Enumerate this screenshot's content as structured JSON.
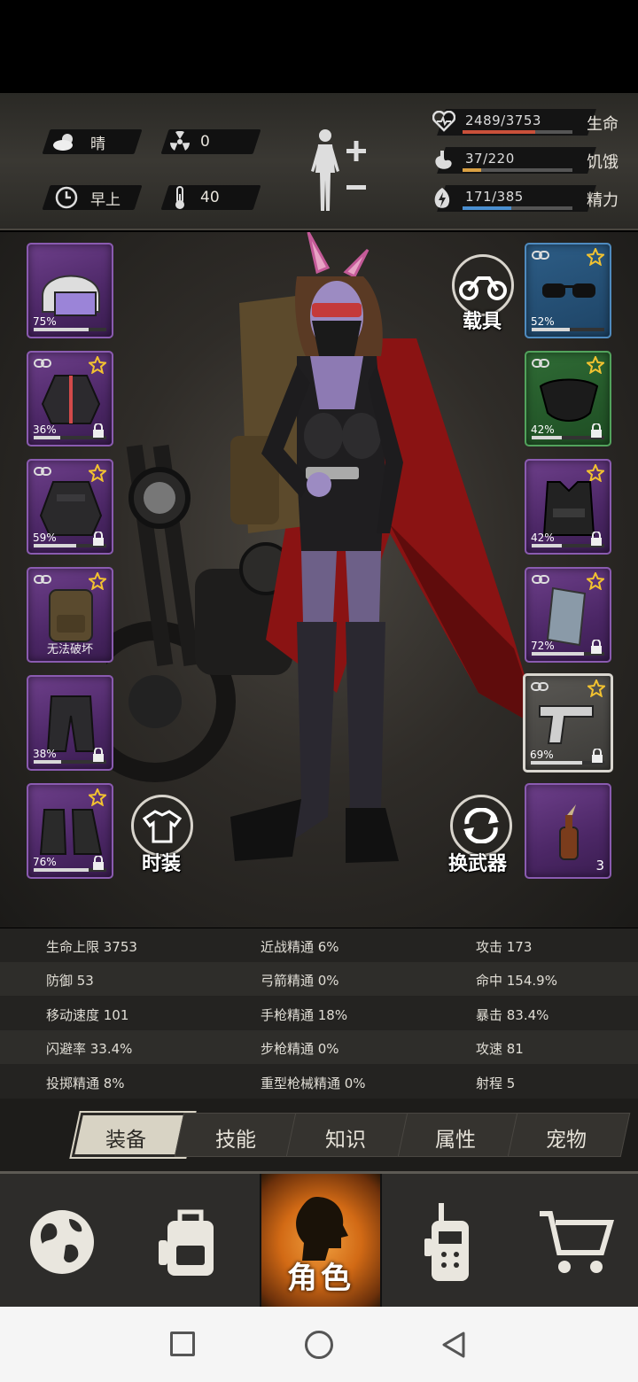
{
  "header": {
    "weather": {
      "label": "晴",
      "icon": "cloud-sun-icon"
    },
    "radiation": {
      "value": "0",
      "icon": "radiation-icon"
    },
    "time_of_day": {
      "label": "早上",
      "icon": "clock-icon"
    },
    "temperature": {
      "value": "40",
      "icon": "thermometer-icon"
    },
    "stats": [
      {
        "name": "生命",
        "value": "2489/3753",
        "fraction": 0.663,
        "color": "#c9503a",
        "icon": "heart-pulse-icon"
      },
      {
        "name": "饥饿",
        "value": "37/220",
        "fraction": 0.168,
        "color": "#d9a043",
        "icon": "stomach-icon"
      },
      {
        "name": "精力",
        "value": "171/385",
        "fraction": 0.444,
        "color": "#4a8fd0",
        "icon": "energy-icon"
      }
    ]
  },
  "left_slots": [
    {
      "name": "helmet",
      "percent": "75%",
      "durability": 0.75,
      "rarity": "purple"
    },
    {
      "name": "jacket",
      "percent": "36%",
      "durability": 0.36,
      "rarity": "purple",
      "starred": true,
      "locked": true
    },
    {
      "name": "coat",
      "percent": "59%",
      "durability": 0.59,
      "rarity": "purple",
      "starred": true,
      "locked": true
    },
    {
      "name": "backpack",
      "note": "无法破坏",
      "rarity": "purple",
      "starred": true
    },
    {
      "name": "pants",
      "percent": "38%",
      "durability": 0.38,
      "rarity": "purple",
      "locked": true
    },
    {
      "name": "boots",
      "percent": "76%",
      "durability": 0.76,
      "rarity": "purple",
      "starred": true,
      "locked": true
    }
  ],
  "right_slots": [
    {
      "name": "sunglasses",
      "percent": "52%",
      "durability": 0.52,
      "rarity": "blue",
      "starred": true
    },
    {
      "name": "face-mask",
      "percent": "42%",
      "durability": 0.42,
      "rarity": "green",
      "starred": true,
      "locked": true
    },
    {
      "name": "police-vest",
      "percent": "42%",
      "durability": 0.42,
      "rarity": "purple",
      "starred": true,
      "locked": true
    },
    {
      "name": "riot-shield",
      "percent": "72%",
      "durability": 0.72,
      "rarity": "purple",
      "starred": true,
      "locked": true
    },
    {
      "name": "pistol",
      "percent": "69%",
      "durability": 0.69,
      "rarity": "grey",
      "starred": true,
      "locked": true
    },
    {
      "name": "molotov",
      "count": "3",
      "rarity": "purple"
    }
  ],
  "buttons": {
    "vehicle": "载具",
    "fashion": "时装",
    "swap_weapon": "换武器"
  },
  "attributes": [
    [
      "生命上限 3753",
      "近战精通 6%",
      "攻击 173"
    ],
    [
      "防御 53",
      "弓箭精通 0%",
      "命中 154.9%"
    ],
    [
      "移动速度 101",
      "手枪精通 18%",
      "暴击 83.4%"
    ],
    [
      "闪避率 33.4%",
      "步枪精通 0%",
      "攻速 81"
    ],
    [
      "投掷精通 8%",
      "重型枪械精通 0%",
      "射程 5"
    ]
  ],
  "tabs": [
    "装备",
    "技能",
    "知识",
    "属性",
    "宠物"
  ],
  "active_tab": 0,
  "nav": {
    "items": [
      "world-map",
      "inventory",
      "character",
      "radio",
      "shop"
    ],
    "active_label": "角色"
  }
}
